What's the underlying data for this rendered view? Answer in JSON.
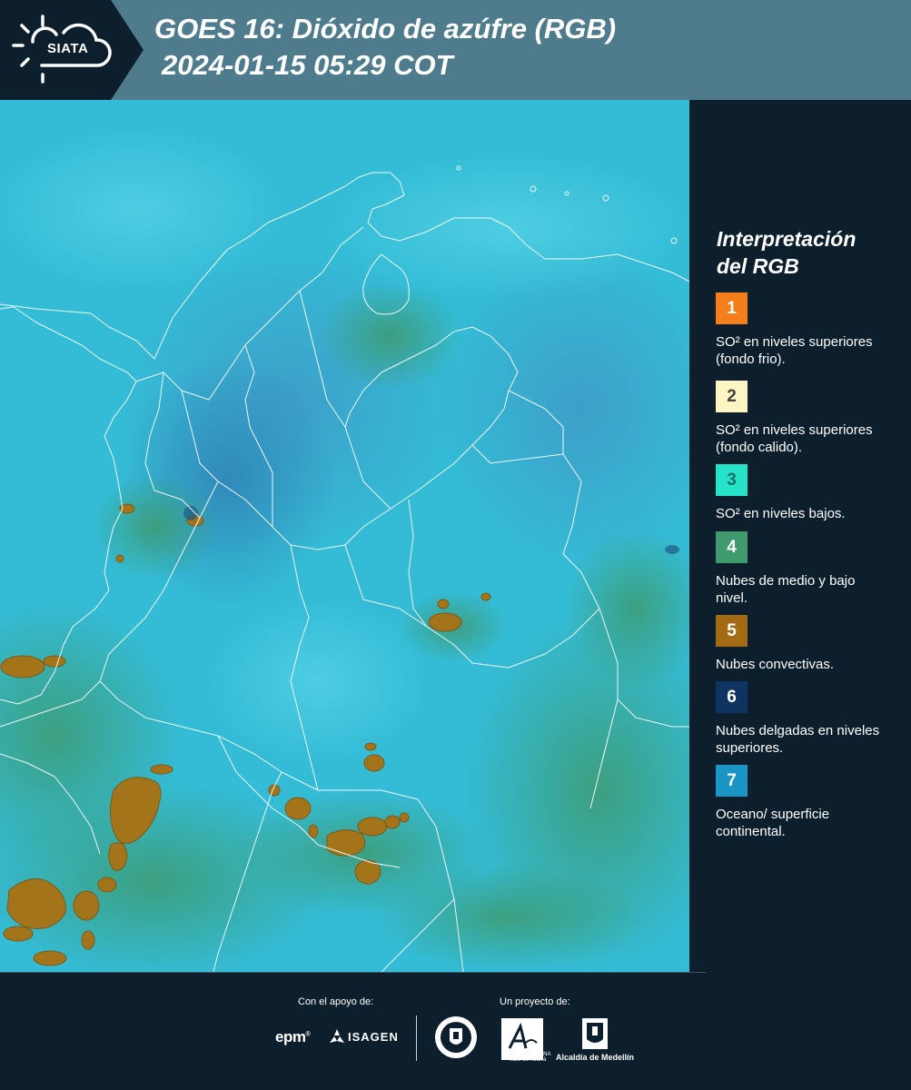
{
  "header": {
    "logo_text": "SIATA",
    "title_line1": "GOES 16: Dióxido de azúfre (RGB)",
    "title_line2": "2024-01-15 05:29 COT"
  },
  "legend": {
    "title_line1": "Interpretación",
    "title_line2": "del RGB",
    "items": [
      {
        "number": "1",
        "label": "SO² en niveles superiores (fondo frio).",
        "color": "#f47f1a"
      },
      {
        "number": "2",
        "label": "SO² en niveles superiores (fondo calido).",
        "color": "#fdf6c3"
      },
      {
        "number": "3",
        "label": "SO² en niveles bajos.",
        "color": "#25e3c8"
      },
      {
        "number": "4",
        "label": "Nubes de medio y bajo nivel.",
        "color": "#3f9a6d"
      },
      {
        "number": "5",
        "label": "Nubes convectivas.",
        "color": "#a36b13"
      },
      {
        "number": "6",
        "label": "Nubes delgadas en niveles superiores.",
        "color": "#0f3462"
      },
      {
        "number": "7",
        "label": "Oceano/ superficie continental.",
        "color": "#1b95c5"
      }
    ]
  },
  "footer": {
    "support_label": "Con el apoyo de:",
    "project_label": "Un proyecto de:",
    "sponsor1": "epm",
    "sponsor2": "ISAGEN",
    "area_text": "METROPOLITANA Valle de Aburrá",
    "alcaldia_text": "Alcaldía de Medellín"
  },
  "colors": {
    "header_bg": "#4e7c8c",
    "panel_bg": "#0d1f2c",
    "map_cyan": "#34bcd6"
  }
}
